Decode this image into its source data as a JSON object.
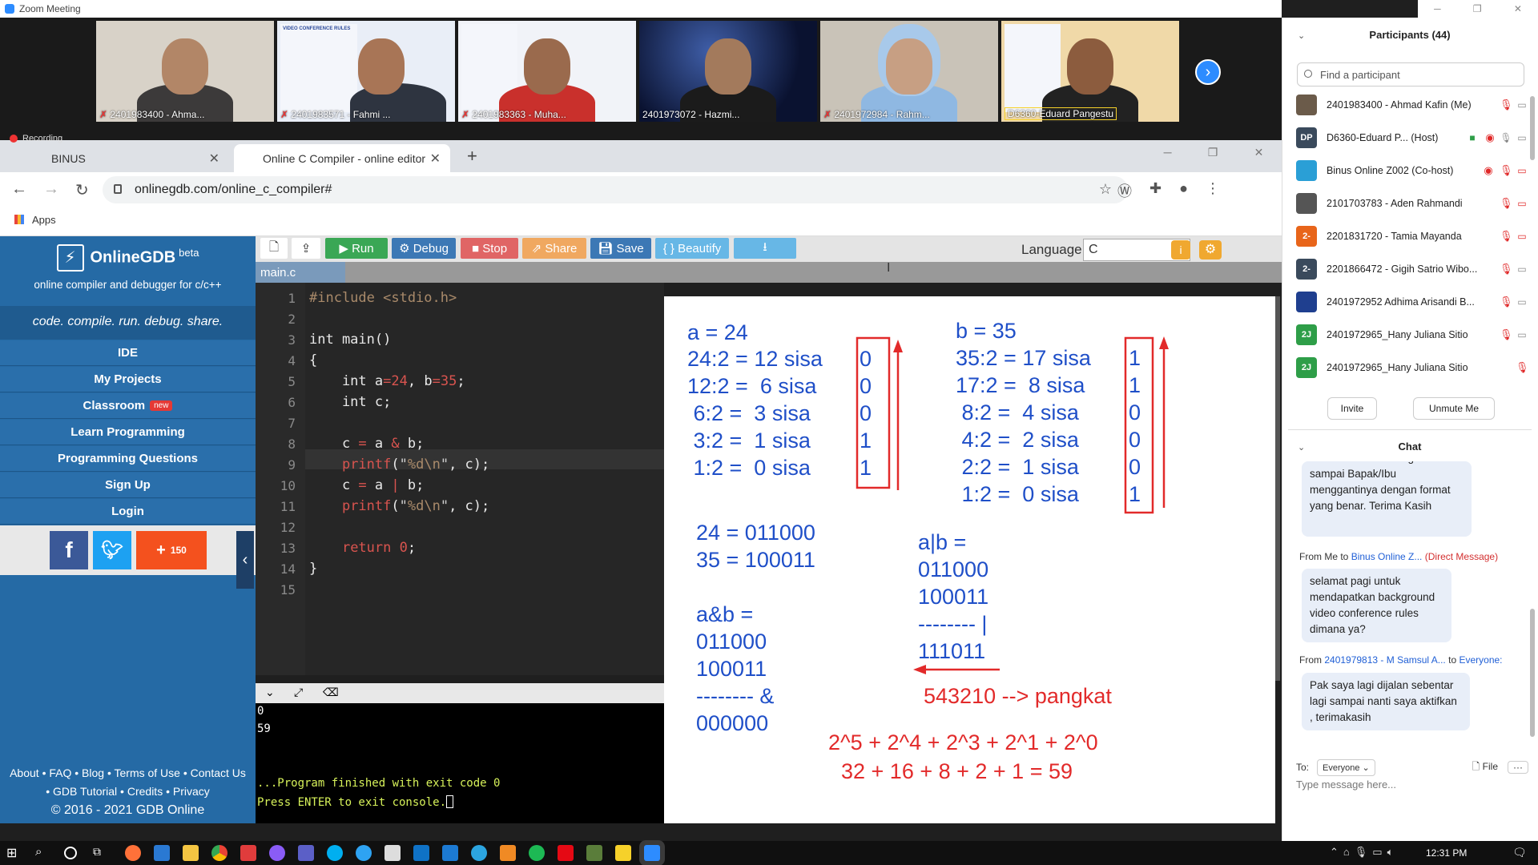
{
  "zoom": {
    "window_title": "Zoom Meeting",
    "recording_label": "Recording",
    "video_tiles": [
      {
        "label": "2401983400 - Ahma..."
      },
      {
        "label": "2401983571 - Fahmi ..."
      },
      {
        "label": "2401983363 - Muha..."
      },
      {
        "label": "2401973072 - Hazmi..."
      },
      {
        "label": "2401972984 - Rahm..."
      },
      {
        "label": "D6360-Eduard Pangestu"
      }
    ],
    "slide_title": "VIDEO CONFERENCE RULES",
    "participants": {
      "title": "Participants (44)",
      "search_placeholder": "Find a participant",
      "list": [
        {
          "name": "2401983400 - Ahmad Kafin (Me)",
          "initials": "",
          "color": "#6b5b4a"
        },
        {
          "name": "D6360-Eduard P... (Host)",
          "initials": "DP",
          "color": "#3a4a5c"
        },
        {
          "name": "Binus Online Z002 (Co-host)",
          "initials": "",
          "color": "#2a9fd6"
        },
        {
          "name": "2101703783 - Aden Rahmandi",
          "initials": "",
          "color": "#555555"
        },
        {
          "name": "2201831720 - Tamia Mayanda",
          "initials": "2-",
          "color": "#e8651a"
        },
        {
          "name": "2201866472 - Gigih Satrio Wibo...",
          "initials": "2-",
          "color": "#3a4a5c"
        },
        {
          "name": "2401972952 Adhima Arisandi B...",
          "initials": "",
          "color": "#1f3f8f"
        },
        {
          "name": "2401972965_Hany Juliana Sitio",
          "initials": "2J",
          "color": "#2e9e48"
        },
        {
          "name": "2401972965_Hany Juliana Sitio",
          "initials": "2J",
          "color": "#2e9e48"
        }
      ],
      "invite_label": "Invite",
      "unmute_label": "Unmute Me"
    },
    "chat": {
      "title": "Chat",
      "msg1": "sementara ke Waiting Room sampai Bapak/Ibu menggantinya dengan format yang benar. Terima Kasih",
      "meta2_from": "From Me to",
      "meta2_to": "Binus Online Z...",
      "meta2_tag": "(Direct Message)",
      "msg2": "selamat pagi untuk mendapatkan background video conference rules dimana ya?",
      "meta3_from": "From",
      "meta3_sender": "2401979813 - M Samsul A...",
      "meta3_to_word": "to",
      "meta3_to": "Everyone:",
      "msg3": "Pak saya lagi dijalan sebentar lagi sampai nanti saya aktifkan , terimakasih",
      "to_label": "To:",
      "to_value": "Everyone",
      "file_label": "File",
      "input_placeholder": "Type message here..."
    }
  },
  "browser": {
    "tabs": [
      {
        "label": "BINUS"
      },
      {
        "label": "Online C Compiler - online editor"
      }
    ],
    "url": "onlinegdb.com/online_c_compiler#",
    "bookmark_apps": "Apps"
  },
  "gdb": {
    "logo_name": "OnlineGDB",
    "logo_beta": "beta",
    "tagline": "online compiler and debugger for c/c++",
    "slogan": "code. compile. run. debug. share.",
    "menu": [
      "IDE",
      "My Projects",
      "Classroom",
      "Learn Programming",
      "Programming Questions",
      "Sign Up",
      "Login"
    ],
    "menu_new_badge": "new",
    "share_count": "150",
    "footer_line1": "About • FAQ • Blog • Terms of Use • Contact Us",
    "footer_line2": "• GDB Tutorial • Credits • Privacy",
    "footer_line3": "© 2016 - 2021 GDB Online",
    "toolbar": {
      "run": "Run",
      "debug": "Debug",
      "stop": "Stop",
      "share": "Share",
      "save": "Save",
      "beautify": "{ } Beautify",
      "language_label": "Language",
      "language_value": "C"
    },
    "file_tab": "main.c",
    "code_line_numbers": [
      "1",
      "2",
      "3",
      "4",
      "5",
      "6",
      "7",
      "8",
      "9",
      "10",
      "11",
      "12",
      "13",
      "14",
      "15"
    ],
    "console_out": [
      "0",
      "59"
    ],
    "console_finish": "...Program finished with exit code 0",
    "console_press": "Press ENTER to exit console."
  },
  "whiteboard": {
    "a_eq": "a = 24",
    "a_rows": [
      "24:2 = 12 sisa",
      "12:2 =  6 sisa",
      " 6:2 =  3 sisa",
      " 3:2 =  1 sisa",
      " 1:2 =  0 sisa"
    ],
    "a_bits": [
      "0",
      "0",
      "0",
      "1",
      "1"
    ],
    "b_eq": "b = 35",
    "b_rows": [
      "35:2 = 17 sisa",
      "17:2 =  8 sisa",
      " 8:2 =  4 sisa",
      " 4:2 =  2 sisa",
      " 2:2 =  1 sisa",
      " 1:2 =  0 sisa"
    ],
    "b_bits": [
      "1",
      "1",
      "0",
      "0",
      "0",
      "1"
    ],
    "bin_a": "24 = 011000",
    "bin_b": "35 = 100011",
    "and_lines": [
      "a&b =",
      "011000",
      "100011",
      "-------- &",
      "000000"
    ],
    "or_lines": [
      "a|b =",
      "011000",
      "100011",
      "-------- |",
      "111011"
    ],
    "pangkat": "543210 --> pangkat",
    "powers": "2^5 + 2^4 + 2^3 + 2^1 + 2^0",
    "sum": "32 + 16 + 8 + 2 + 1 = 59"
  },
  "taskbar": {
    "clock": "12:31 PM"
  }
}
